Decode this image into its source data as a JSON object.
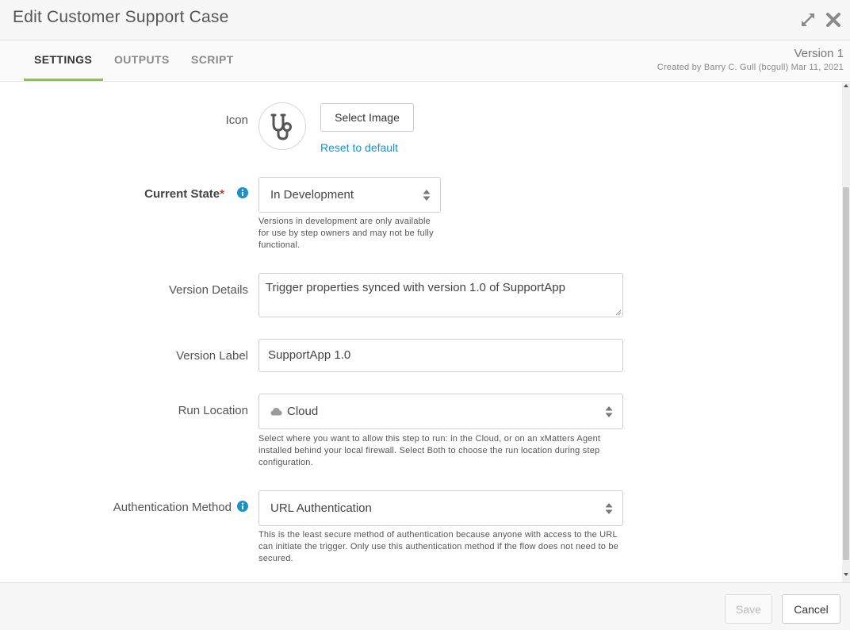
{
  "window": {
    "title": "Edit Customer Support Case"
  },
  "tabs": [
    {
      "label": "SETTINGS",
      "active": true
    },
    {
      "label": "OUTPUTS",
      "active": false
    },
    {
      "label": "SCRIPT",
      "active": false
    }
  ],
  "version": {
    "title": "Version 1",
    "meta": "Created by Barry C. Gull (bcgull) Mar 11, 2021"
  },
  "icon_field": {
    "label": "Icon",
    "icon_name": "stethoscope-icon",
    "select_button": "Select Image",
    "reset_link": "Reset to default"
  },
  "current_state": {
    "label": "Current State",
    "required_mark": "*",
    "value": "In Development",
    "help": "Versions in development are only available for use by step owners and may not be fully functional."
  },
  "version_details": {
    "label": "Version Details",
    "value": "Trigger properties synced with version 1.0 of SupportApp"
  },
  "version_label": {
    "label": "Version Label",
    "value": "SupportApp 1.0"
  },
  "run_location": {
    "label": "Run Location",
    "icon_name": "cloud-icon",
    "value": "Cloud",
    "help": "Select where you want to allow this step to run: in the Cloud, or on an xMatters Agent installed behind your local firewall. Select Both to choose the run location during step configuration."
  },
  "authentication_method": {
    "label": "Authentication Method",
    "value": "URL Authentication",
    "help": "This is the least secure method of authentication because anyone with access to the URL can initiate the trigger. Only use this authentication method if the flow does not need to be secured."
  },
  "footer": {
    "save_label": "Save",
    "cancel_label": "Cancel"
  },
  "colors": {
    "accent_underline": "#8cc53f",
    "link": "#1a91c9",
    "info_icon": "#1a91c9",
    "required": "#d9342b"
  }
}
